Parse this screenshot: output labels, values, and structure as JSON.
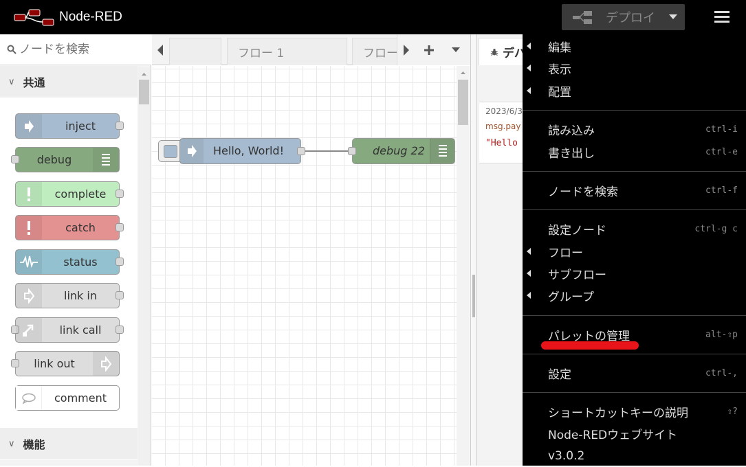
{
  "header": {
    "app_title": "Node-RED",
    "deploy_label": "デプロイ",
    "accent": "#8f0000"
  },
  "palette": {
    "search_placeholder": "ノードを検索",
    "categories": [
      {
        "label": "共通"
      },
      {
        "label": "機能"
      }
    ],
    "nodes": [
      {
        "label": "inject",
        "color": "#a6bbcf",
        "icon": "arrow-right-icon"
      },
      {
        "label": "debug",
        "color": "#87a980",
        "icon": "list-icon"
      },
      {
        "label": "complete",
        "color": "#c0edc0",
        "icon": "exclamation-icon"
      },
      {
        "label": "catch",
        "color": "#e49191",
        "icon": "exclamation-icon"
      },
      {
        "label": "status",
        "color": "#94c1d0",
        "icon": "pulse-icon"
      },
      {
        "label": "link in",
        "color": "#dddddd",
        "icon": "link-in-icon"
      },
      {
        "label": "link call",
        "color": "#dddddd",
        "icon": "link-call-icon"
      },
      {
        "label": "link out",
        "color": "#dddddd",
        "icon": "link-out-icon"
      },
      {
        "label": "comment",
        "color": "#ffffff",
        "icon": "comment-icon"
      }
    ]
  },
  "workspace": {
    "tabs": [
      {
        "label": ""
      },
      {
        "label": "フロー 1"
      },
      {
        "label": "フロー"
      }
    ],
    "flow_nodes": [
      {
        "label": "Hello, World!",
        "color": "#a6bbcf"
      },
      {
        "label": "debug 22",
        "color": "#87a980"
      }
    ]
  },
  "sidebar": {
    "tab_label": "デバ",
    "message": {
      "timestamp": "2023/6/3",
      "path": "msg.pay",
      "value": "\"Hello"
    }
  },
  "menu": {
    "highlight_color": "#e8141a",
    "items": [
      {
        "label": "編集",
        "shortcut": "",
        "submenu": true
      },
      {
        "label": "表示",
        "shortcut": "",
        "submenu": true
      },
      {
        "label": "配置",
        "shortcut": "",
        "submenu": true
      },
      {
        "label": "読み込み",
        "shortcut": "ctrl-i",
        "submenu": false
      },
      {
        "label": "書き出し",
        "shortcut": "ctrl-e",
        "submenu": false
      },
      {
        "label": "ノードを検索",
        "shortcut": "ctrl-f",
        "submenu": false
      },
      {
        "label": "設定ノード",
        "shortcut": "ctrl-g c",
        "submenu": false
      },
      {
        "label": "フロー",
        "shortcut": "",
        "submenu": true
      },
      {
        "label": "サブフロー",
        "shortcut": "",
        "submenu": true
      },
      {
        "label": "グループ",
        "shortcut": "",
        "submenu": true
      },
      {
        "label": "パレットの管理",
        "shortcut": "alt-⇧p",
        "submenu": false
      },
      {
        "label": "設定",
        "shortcut": "ctrl-,",
        "submenu": false
      },
      {
        "label": "ショートカットキーの説明",
        "shortcut": "⇧?",
        "submenu": false
      },
      {
        "label": "Node-REDウェブサイト",
        "shortcut": "",
        "submenu": false
      },
      {
        "label": "v3.0.2",
        "shortcut": "",
        "submenu": false
      }
    ]
  }
}
